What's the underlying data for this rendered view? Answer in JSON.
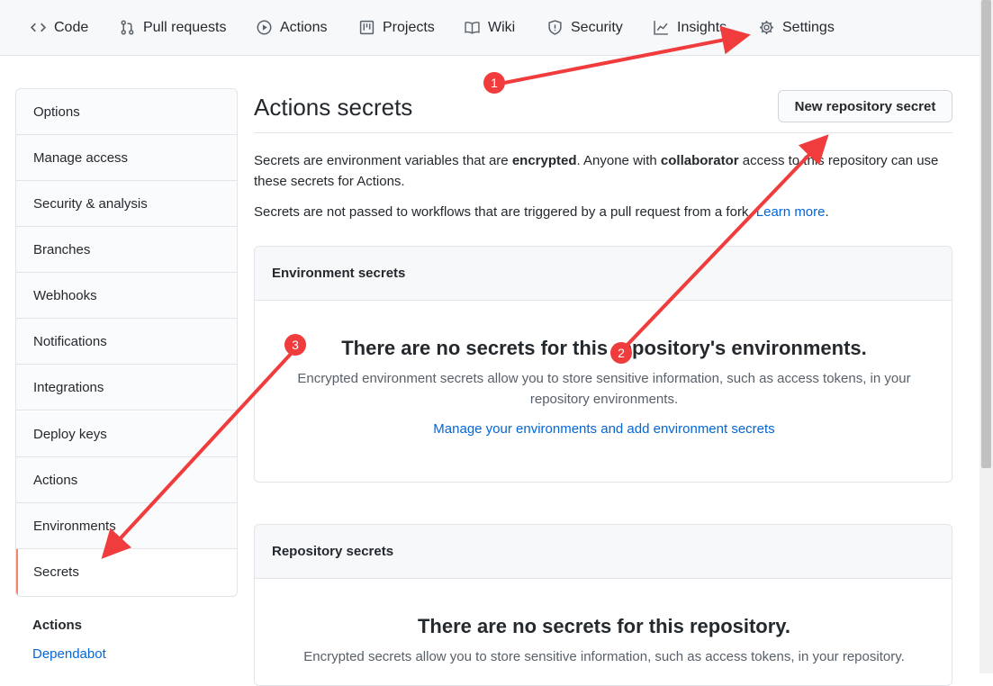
{
  "nav": {
    "tabs": [
      {
        "label": "Code",
        "icon": "code-icon"
      },
      {
        "label": "Pull requests",
        "icon": "pull-request-icon"
      },
      {
        "label": "Actions",
        "icon": "play-icon"
      },
      {
        "label": "Projects",
        "icon": "project-board-icon"
      },
      {
        "label": "Wiki",
        "icon": "book-icon"
      },
      {
        "label": "Security",
        "icon": "shield-icon"
      },
      {
        "label": "Insights",
        "icon": "graph-icon"
      },
      {
        "label": "Settings",
        "icon": "gear-icon"
      }
    ]
  },
  "sidebar": {
    "items": [
      {
        "label": "Options"
      },
      {
        "label": "Manage access"
      },
      {
        "label": "Security & analysis"
      },
      {
        "label": "Branches"
      },
      {
        "label": "Webhooks"
      },
      {
        "label": "Notifications"
      },
      {
        "label": "Integrations"
      },
      {
        "label": "Deploy keys"
      },
      {
        "label": "Actions"
      },
      {
        "label": "Environments"
      },
      {
        "label": "Secrets",
        "selected": true
      }
    ],
    "section_heading": "Actions",
    "section_link": "Dependabot"
  },
  "main": {
    "title": "Actions secrets",
    "new_button": "New repository secret",
    "intro": {
      "p1_a": "Secrets are environment variables that are ",
      "p1_b": "encrypted",
      "p1_c": ". Anyone with ",
      "p1_d": "collaborator",
      "p1_e": " access to this repository can use these secrets for Actions.",
      "p2_a": "Secrets are not passed to workflows that are triggered by a pull request from a fork. ",
      "p2_link": "Learn more",
      "p2_end": "."
    },
    "env_box": {
      "header": "Environment secrets",
      "title": "There are no secrets for this repository's environments.",
      "desc": "Encrypted environment secrets allow you to store sensitive information, such as access tokens, in your repository environments.",
      "link": "Manage your environments and add environment secrets"
    },
    "repo_box": {
      "header": "Repository secrets",
      "title": "There are no secrets for this repository.",
      "desc": "Encrypted secrets allow you to store sensitive information, such as access tokens, in your repository."
    }
  },
  "annotations": {
    "markers": [
      "1",
      "2",
      "3"
    ],
    "color": "#f03c3c"
  }
}
